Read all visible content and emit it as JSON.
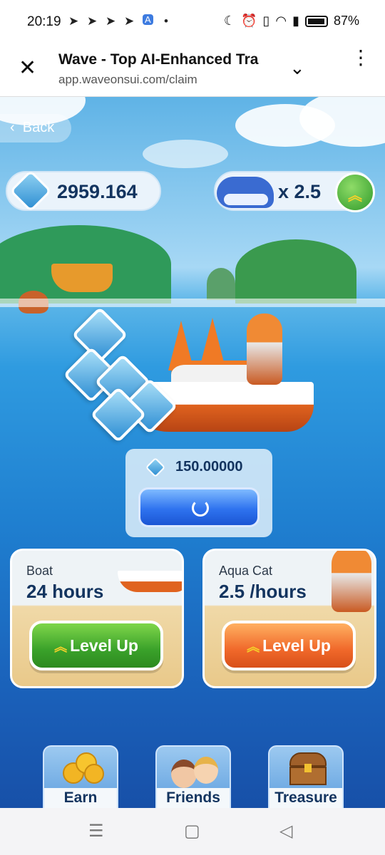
{
  "status_bar": {
    "time": "20:19",
    "battery": "87%",
    "icons": [
      "telegram-icon",
      "telegram-icon",
      "telegram-icon",
      "telegram-icon",
      "translate-icon",
      "dot-icon",
      "moon-icon",
      "alarm-icon",
      "vibrate-icon",
      "wifi-icon",
      "signal-icon",
      "battery-icon"
    ]
  },
  "browser": {
    "title": "Wave - Top AI-Enhanced Tra",
    "url": "app.waveonsui.com/claim"
  },
  "game": {
    "back_label": "Back",
    "balance": "2959.164",
    "multiplier": "x 2.5",
    "claim": {
      "amount": "150.00000"
    },
    "cards": [
      {
        "label": "Boat",
        "value": "24 hours",
        "button": "Level Up",
        "color": "#3aa12a"
      },
      {
        "label": "Aqua Cat",
        "value": "2.5 /hours",
        "button": "Level Up",
        "color": "#f0682a"
      }
    ],
    "nav": [
      {
        "label": "Earn",
        "icon": "coins-icon"
      },
      {
        "label": "Friends",
        "icon": "friends-icon"
      },
      {
        "label": "Treasure",
        "icon": "treasure-chest-icon"
      }
    ]
  },
  "colors": {
    "accent_blue": "#2f73ef",
    "text_navy": "#13345f",
    "level_up_green": "#3aa12a",
    "level_up_orange": "#f0682a"
  }
}
